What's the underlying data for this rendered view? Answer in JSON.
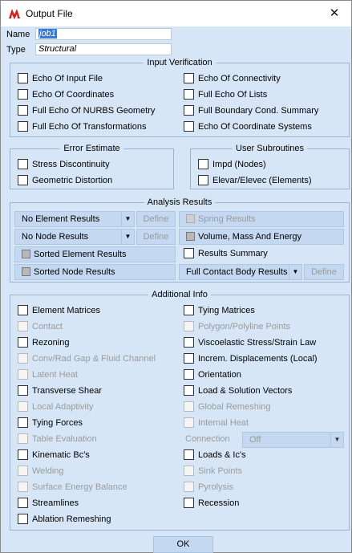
{
  "window": {
    "title": "Output File",
    "close_glyph": "✕"
  },
  "name_label": "Name",
  "name_value": "job1",
  "type_label": "Type",
  "type_value": "Structural",
  "input_verification": {
    "title": "Input Verification",
    "items": [
      "Echo Of Input File",
      "Echo Of Connectivity",
      "Echo Of Coordinates",
      "Full Echo Of Lists",
      "Full Echo Of NURBS Geometry",
      "Full Boundary Cond. Summary",
      "Full Echo Of Transformations",
      "Echo Of Coordinate Systems"
    ]
  },
  "error_estimate": {
    "title": "Error Estimate",
    "items": [
      "Stress Discontinuity",
      "Geometric Distortion"
    ]
  },
  "user_subroutines": {
    "title": "User Subroutines",
    "items": [
      "Impd (Nodes)",
      "Elevar/Elevec (Elements)"
    ]
  },
  "analysis_results": {
    "title": "Analysis Results",
    "element_results": "No Element Results",
    "node_results": "No Node Results",
    "define": "Define",
    "spring_results": "Spring Results",
    "volume_mass_energy": "Volume, Mass And Energy",
    "sorted_element_results": "Sorted Element Results",
    "results_summary": "Results Summary",
    "sorted_node_results": "Sorted Node Results",
    "contact_body_results": "Full Contact Body Results"
  },
  "additional_info": {
    "title": "Additional Info",
    "items": [
      "Element Matrices",
      "Tying Matrices",
      "Contact",
      "Polygon/Polyline Points",
      "Rezoning",
      "Viscoelastic Stress/Strain Law",
      "Conv/Rad Gap & Fluid Channel",
      "Increm. Displacements (Local)",
      "Latent Heat",
      "Orientation",
      "Transverse Shear",
      "Load & Solution Vectors",
      "Local Adaptivity",
      "Global Remeshing",
      "Tying Forces",
      "Internal Heat",
      "Table Evaluation",
      "Kinematic Bc's",
      "Loads & Ic's",
      "Welding",
      "Sink Points",
      "Surface Energy Balance",
      "Pyrolysis",
      "Streamlines",
      "Recession",
      "Ablation Remeshing"
    ],
    "connection_label": "Connection",
    "connection_value": "Off"
  },
  "ok_label": "OK",
  "accent_color": "#3a78d6"
}
